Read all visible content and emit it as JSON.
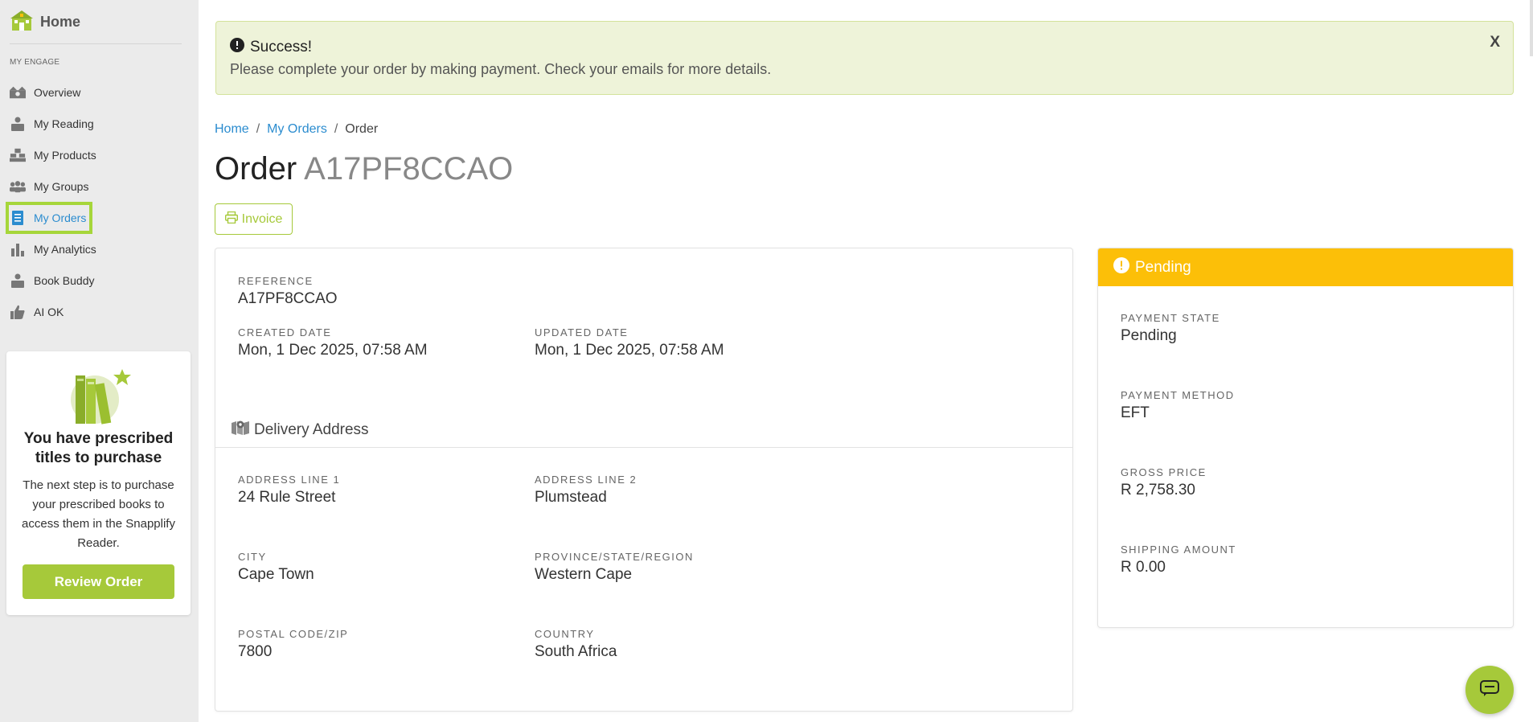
{
  "sidebar": {
    "home_label": "Home",
    "section_label": "MY ENGAGE",
    "items": [
      {
        "label": "Overview",
        "icon": "overview-icon"
      },
      {
        "label": "My Reading",
        "icon": "reading-icon"
      },
      {
        "label": "My Products",
        "icon": "products-icon"
      },
      {
        "label": "My Groups",
        "icon": "groups-icon"
      },
      {
        "label": "My Orders",
        "icon": "orders-icon",
        "active": true
      },
      {
        "label": "My Analytics",
        "icon": "analytics-icon"
      },
      {
        "label": "Book Buddy",
        "icon": "book-buddy-icon"
      },
      {
        "label": "AI OK",
        "icon": "thumbs-up-icon"
      }
    ],
    "promo": {
      "title": "You have prescribed titles to purchase",
      "description": "The next step is to purchase your prescribed books to access them in the Snapplify Reader.",
      "button": "Review Order"
    }
  },
  "alert": {
    "title": "Success!",
    "message": "Please complete your order by making payment. Check your emails for more details.",
    "close": "X"
  },
  "breadcrumb": {
    "home": "Home",
    "orders": "My Orders",
    "current": "Order",
    "separator": "/"
  },
  "order": {
    "title_prefix": "Order",
    "id": "A17PF8CCAO",
    "invoice_label": "Invoice",
    "reference_label": "REFERENCE",
    "reference": "A17PF8CCAO",
    "created_label": "CREATED DATE",
    "created": "Mon, 1 Dec 2025, 07:58 AM",
    "updated_label": "UPDATED DATE",
    "updated": "Mon, 1 Dec 2025, 07:58 AM"
  },
  "delivery": {
    "heading": "Delivery Address",
    "address1_label": "ADDRESS LINE 1",
    "address1": "24 Rule Street",
    "address2_label": "ADDRESS LINE 2",
    "address2": "Plumstead",
    "city_label": "CITY",
    "city": "Cape Town",
    "province_label": "PROVINCE/STATE/REGION",
    "province": "Western Cape",
    "postal_label": "POSTAL CODE/ZIP",
    "postal": "7800",
    "country_label": "COUNTRY",
    "country": "South Africa"
  },
  "payment": {
    "status": "Pending",
    "state_label": "PAYMENT STATE",
    "state": "Pending",
    "method_label": "PAYMENT METHOD",
    "method": "EFT",
    "gross_label": "GROSS PRICE",
    "gross": "R 2,758.30",
    "shipping_label": "SHIPPING AMOUNT",
    "shipping": "R 0.00"
  },
  "colors": {
    "accent_green": "#a6c93a",
    "link_blue": "#2b8ccf",
    "pending_yellow": "#fcbf08",
    "alert_bg": "#eef3d9"
  }
}
